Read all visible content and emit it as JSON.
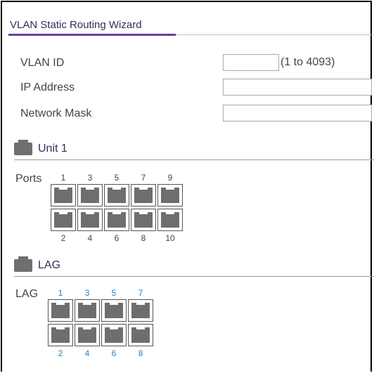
{
  "wizard": {
    "title": "VLAN Static Routing Wizard",
    "vlan_id_label": "VLAN ID",
    "vlan_id_value": "",
    "vlan_range_hint": "(1 to 4093)",
    "ip_address_label": "IP Address",
    "ip_address_value": "",
    "network_mask_label": "Network Mask",
    "network_mask_value": ""
  },
  "unit": {
    "title": "Unit 1",
    "ports_label": "Ports",
    "top_numbers": [
      "1",
      "3",
      "5",
      "7",
      "9"
    ],
    "bottom_numbers": [
      "2",
      "4",
      "6",
      "8",
      "10"
    ]
  },
  "lag": {
    "title": "LAG",
    "row_label": "LAG",
    "top_numbers": [
      "1",
      "3",
      "5",
      "7"
    ],
    "bottom_numbers": [
      "2",
      "4",
      "6",
      "8"
    ]
  },
  "colors": {
    "title_accent": "#6b3fa0",
    "lag_number": "#2a7fc0",
    "port_fill": "#6e6e6e"
  }
}
